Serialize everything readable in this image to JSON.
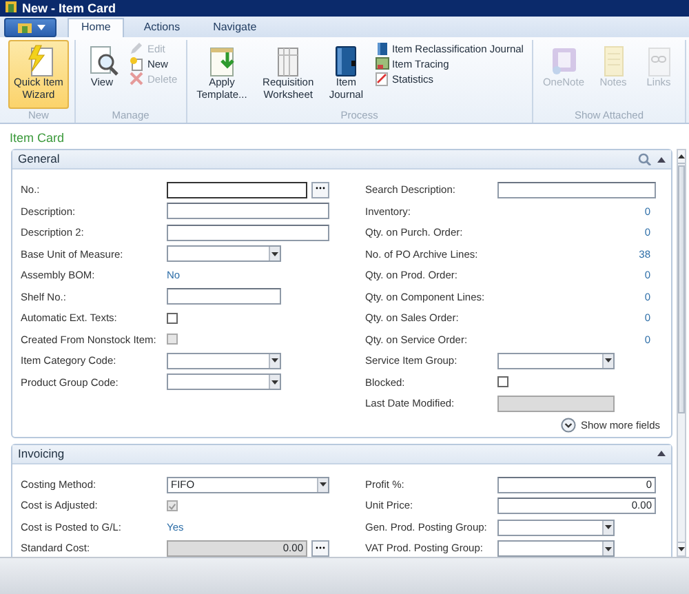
{
  "window": {
    "title": "New - Item Card"
  },
  "ribbon": {
    "tabs": [
      {
        "label": "Home",
        "selected": true
      },
      {
        "label": "Actions",
        "selected": false
      },
      {
        "label": "Navigate",
        "selected": false
      }
    ],
    "groups": [
      {
        "label": "New",
        "items": [
          {
            "label": "Quick Item Wizard",
            "kind": "large",
            "disabled": false,
            "highlighted": true
          }
        ]
      },
      {
        "label": "Manage",
        "items": [
          {
            "label": "View",
            "kind": "large",
            "disabled": false
          },
          {
            "label": "Edit",
            "kind": "small",
            "disabled": true
          },
          {
            "label": "New",
            "kind": "small",
            "disabled": false
          },
          {
            "label": "Delete",
            "kind": "small",
            "disabled": true
          }
        ]
      },
      {
        "label": "Process",
        "items": [
          {
            "label": "Apply Template...",
            "kind": "large",
            "disabled": false
          },
          {
            "label": "Requisition Worksheet",
            "kind": "large",
            "disabled": false
          },
          {
            "label": "Item Journal",
            "kind": "large",
            "disabled": false
          },
          {
            "label": "Item Reclassification Journal",
            "kind": "small",
            "disabled": false
          },
          {
            "label": "Item Tracing",
            "kind": "small",
            "disabled": false
          },
          {
            "label": "Statistics",
            "kind": "small",
            "disabled": false
          }
        ]
      },
      {
        "label": "Show Attached",
        "items": [
          {
            "label": "OneNote",
            "kind": "large",
            "disabled": true
          },
          {
            "label": "Notes",
            "kind": "large",
            "disabled": true
          },
          {
            "label": "Links",
            "kind": "large",
            "disabled": true
          }
        ]
      }
    ]
  },
  "page_title": "Item Card",
  "sections": [
    {
      "title": "General",
      "expanded": true,
      "show_more": "Show more fields",
      "columns": [
        [
          {
            "label": "No.:",
            "kind": "text",
            "wide": true,
            "lookup": true,
            "focused": true
          },
          {
            "label": "Description:",
            "kind": "text",
            "wide": true
          },
          {
            "label": "Description 2:",
            "kind": "text",
            "wide": true
          },
          {
            "label": "Base Unit of Measure:",
            "kind": "dropdown"
          },
          {
            "label": "Assembly BOM:",
            "kind": "link",
            "value": "No"
          },
          {
            "label": "Shelf No.:",
            "kind": "text"
          },
          {
            "label": "Automatic Ext. Texts:",
            "kind": "checkbox",
            "checked": false,
            "disabled": false
          },
          {
            "label": "Created From Nonstock Item:",
            "kind": "checkbox",
            "checked": false,
            "disabled": true
          },
          {
            "label": "Item Category Code:",
            "kind": "dropdown"
          },
          {
            "label": "Product Group Code:",
            "kind": "dropdown"
          }
        ],
        [
          {
            "label": "Search Description:",
            "kind": "text",
            "wide": true
          },
          {
            "label": "Inventory:",
            "kind": "flowfield",
            "value": "0"
          },
          {
            "label": "Qty. on Purch. Order:",
            "kind": "flowfield",
            "value": "0"
          },
          {
            "label": "No. of PO Archive Lines:",
            "kind": "flowfield",
            "value": "38"
          },
          {
            "label": "Qty. on Prod. Order:",
            "kind": "flowfield",
            "value": "0"
          },
          {
            "label": "Qty. on Component Lines:",
            "kind": "flowfield",
            "value": "0"
          },
          {
            "label": "Qty. on Sales Order:",
            "kind": "flowfield",
            "value": "0"
          },
          {
            "label": "Qty. on Service Order:",
            "kind": "flowfield",
            "value": "0"
          },
          {
            "label": "Service Item Group:",
            "kind": "dropdown"
          },
          {
            "label": "Blocked:",
            "kind": "checkbox",
            "checked": false,
            "disabled": false
          },
          {
            "label": "Last Date Modified:",
            "kind": "text",
            "readonly": true
          }
        ]
      ]
    },
    {
      "title": "Invoicing",
      "expanded": true,
      "columns": [
        [
          {
            "label": "Costing Method:",
            "kind": "dropdown",
            "wide": true,
            "value": "FIFO"
          },
          {
            "label": "Cost is Adjusted:",
            "kind": "checkbox",
            "checked": true,
            "disabled": true
          },
          {
            "label": "Cost is Posted to G/L:",
            "kind": "link",
            "value": "Yes"
          },
          {
            "label": "Standard Cost:",
            "kind": "text",
            "wide": true,
            "lookup": true,
            "readonly": true,
            "value": "0.00"
          }
        ],
        [
          {
            "label": "Profit %:",
            "kind": "text",
            "wide": true,
            "value": "0"
          },
          {
            "label": "Unit Price:",
            "kind": "text",
            "wide": true,
            "value": "0.00"
          },
          {
            "label": "Gen. Prod. Posting Group:",
            "kind": "dropdown"
          },
          {
            "label": "VAT Prod. Posting Group:",
            "kind": "dropdown"
          }
        ]
      ]
    }
  ]
}
